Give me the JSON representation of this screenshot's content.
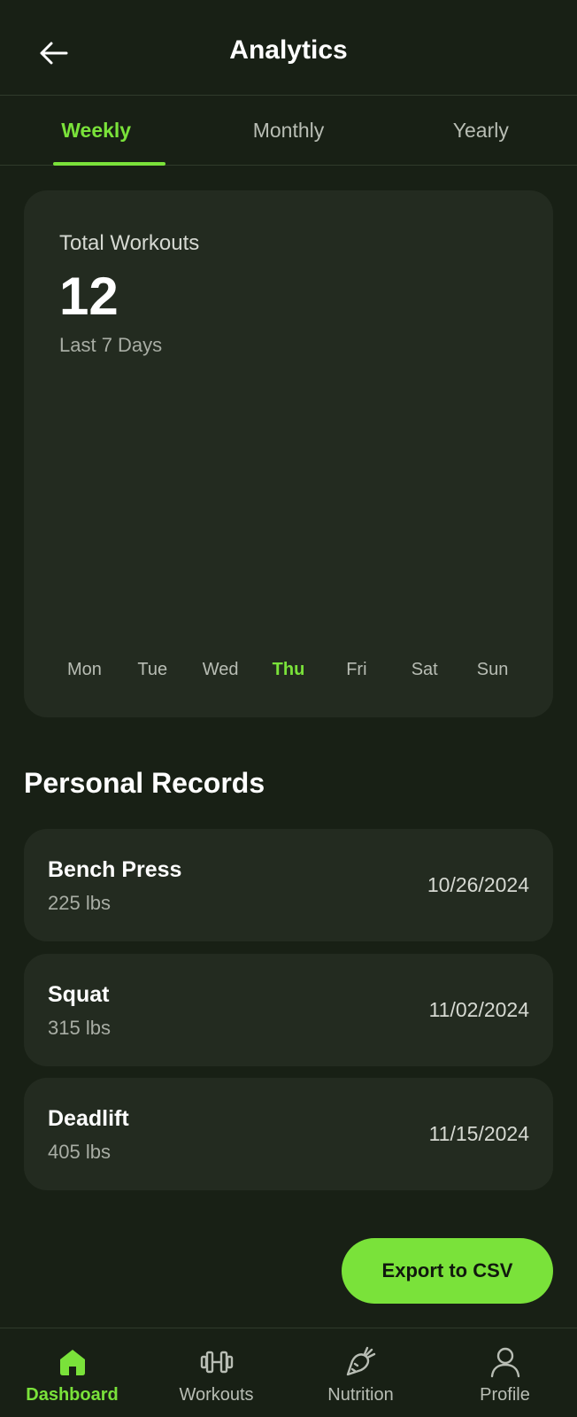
{
  "header": {
    "title": "Analytics"
  },
  "tabs": [
    {
      "label": "Weekly",
      "active": true
    },
    {
      "label": "Monthly",
      "active": false
    },
    {
      "label": "Yearly",
      "active": false
    }
  ],
  "stats": {
    "label": "Total Workouts",
    "value": "12",
    "period": "Last 7 Days",
    "days": [
      "Mon",
      "Tue",
      "Wed",
      "Thu",
      "Fri",
      "Sat",
      "Sun"
    ],
    "active_day": "Thu"
  },
  "records": {
    "title": "Personal Records",
    "items": [
      {
        "name": "Bench Press",
        "weight": "225 lbs",
        "date": "10/26/2024"
      },
      {
        "name": "Squat",
        "weight": "315 lbs",
        "date": "11/02/2024"
      },
      {
        "name": "Deadlift",
        "weight": "405 lbs",
        "date": "11/15/2024"
      }
    ]
  },
  "export": {
    "label": "Export to CSV"
  },
  "nav": [
    {
      "label": "Dashboard",
      "icon": "home-icon",
      "active": true
    },
    {
      "label": "Workouts",
      "icon": "dumbbell-icon",
      "active": false
    },
    {
      "label": "Nutrition",
      "icon": "carrot-icon",
      "active": false
    },
    {
      "label": "Profile",
      "icon": "person-icon",
      "active": false
    }
  ],
  "colors": {
    "background": "#182015",
    "card": "#232b20",
    "accent": "#7ae23a",
    "muted_text": "#b8bdb4"
  }
}
